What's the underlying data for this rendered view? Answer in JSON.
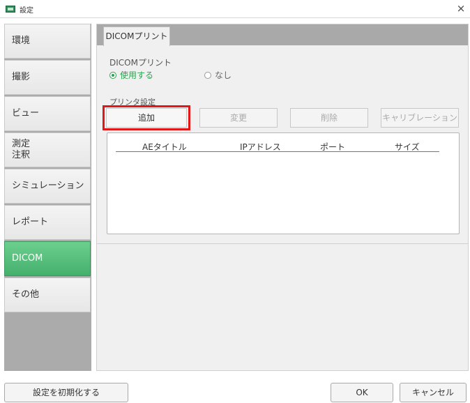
{
  "window": {
    "title": "設定",
    "close_symbol": "×"
  },
  "sidebar": {
    "items": [
      {
        "label": "環境",
        "active": false
      },
      {
        "label": "撮影",
        "active": false
      },
      {
        "label": "ビュー",
        "active": false
      },
      {
        "label": "測定\n注釈",
        "active": false
      },
      {
        "label": "シミュレーション",
        "active": false
      },
      {
        "label": "レポート",
        "active": false
      },
      {
        "label": "DICOM",
        "active": true
      },
      {
        "label": "その他",
        "active": false
      }
    ]
  },
  "tabs": {
    "active": "DICOMプリント"
  },
  "dicom_print": {
    "section_label": "DICOMプリント",
    "options": [
      {
        "label": "使用する",
        "selected": true
      },
      {
        "label": "なし",
        "selected": false
      }
    ]
  },
  "printer_settings": {
    "section_label": "プリンタ設定",
    "buttons": {
      "add": "追加",
      "change": "変更",
      "delete": "削除",
      "calibration": "キャリブレーション"
    },
    "table": {
      "columns": [
        "AEタイトル",
        "IPアドレス",
        "ポート",
        "サイズ"
      ],
      "rows": []
    }
  },
  "footer": {
    "reset_label": "設定を初期化する",
    "ok_label": "OK",
    "cancel_label": "キャンセル"
  },
  "colors": {
    "accent_green": "#45b06d",
    "selected_text_green": "#2aa34f",
    "highlight_red": "#e01818"
  }
}
